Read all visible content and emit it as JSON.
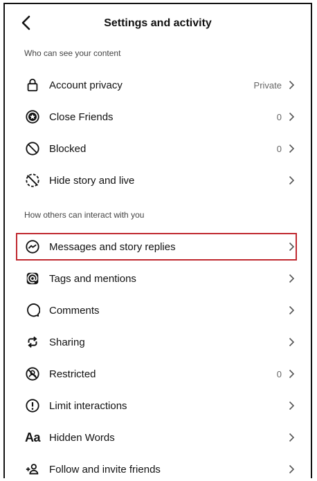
{
  "header": {
    "title": "Settings and activity"
  },
  "sections": [
    {
      "label": "Who can see your content",
      "items": [
        {
          "label": "Account privacy",
          "value": "Private",
          "icon": "lock-icon"
        },
        {
          "label": "Close Friends",
          "value": "0",
          "icon": "star-circle-icon"
        },
        {
          "label": "Blocked",
          "value": "0",
          "icon": "blocked-icon"
        },
        {
          "label": "Hide story and live",
          "value": "",
          "icon": "hide-story-icon"
        }
      ]
    },
    {
      "label": "How others can interact with you",
      "items": [
        {
          "label": "Messages and story replies",
          "value": "",
          "icon": "messenger-icon",
          "highlighted": true
        },
        {
          "label": "Tags and mentions",
          "value": "",
          "icon": "at-sign-icon"
        },
        {
          "label": "Comments",
          "value": "",
          "icon": "comment-icon"
        },
        {
          "label": "Sharing",
          "value": "",
          "icon": "sharing-icon"
        },
        {
          "label": "Restricted",
          "value": "0",
          "icon": "restricted-icon"
        },
        {
          "label": "Limit interactions",
          "value": "",
          "icon": "limit-icon"
        },
        {
          "label": "Hidden Words",
          "value": "",
          "icon": "hidden-words-icon",
          "icon_text": "Aa"
        },
        {
          "label": "Follow and invite friends",
          "value": "",
          "icon": "add-person-icon"
        }
      ]
    }
  ],
  "colors": {
    "highlight": "#c0282f"
  }
}
